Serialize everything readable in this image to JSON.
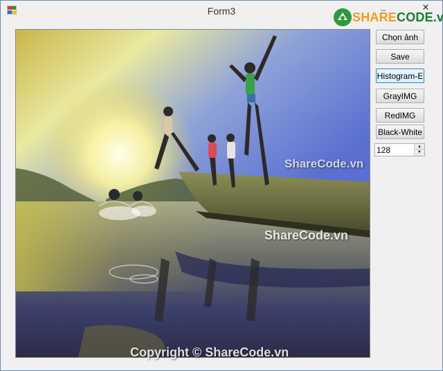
{
  "window": {
    "title": "Form3",
    "minimize_glyph": "_",
    "close_glyph": "✕"
  },
  "buttons": {
    "chon_anh": "Chọn ảnh",
    "save": "Save",
    "histogram": "Histogram-E",
    "gray": "GrayIMG",
    "red": "RedIMG",
    "black_white": "Black-White"
  },
  "numeric": {
    "value": "128",
    "up_glyph": "▲",
    "down_glyph": "▼"
  },
  "watermarks": {
    "logo_part1": "SHARE",
    "logo_part2": "CODE.vn",
    "mid": "ShareCode.vn",
    "center": "ShareCode.vn",
    "footer": "Copyright © ShareCode.vn"
  },
  "colors": {
    "window_bg": "#f0f0f0",
    "button_active_border": "#3c7fb1",
    "logo_orange": "#f39a1e",
    "logo_green": "#1b7a2f"
  }
}
